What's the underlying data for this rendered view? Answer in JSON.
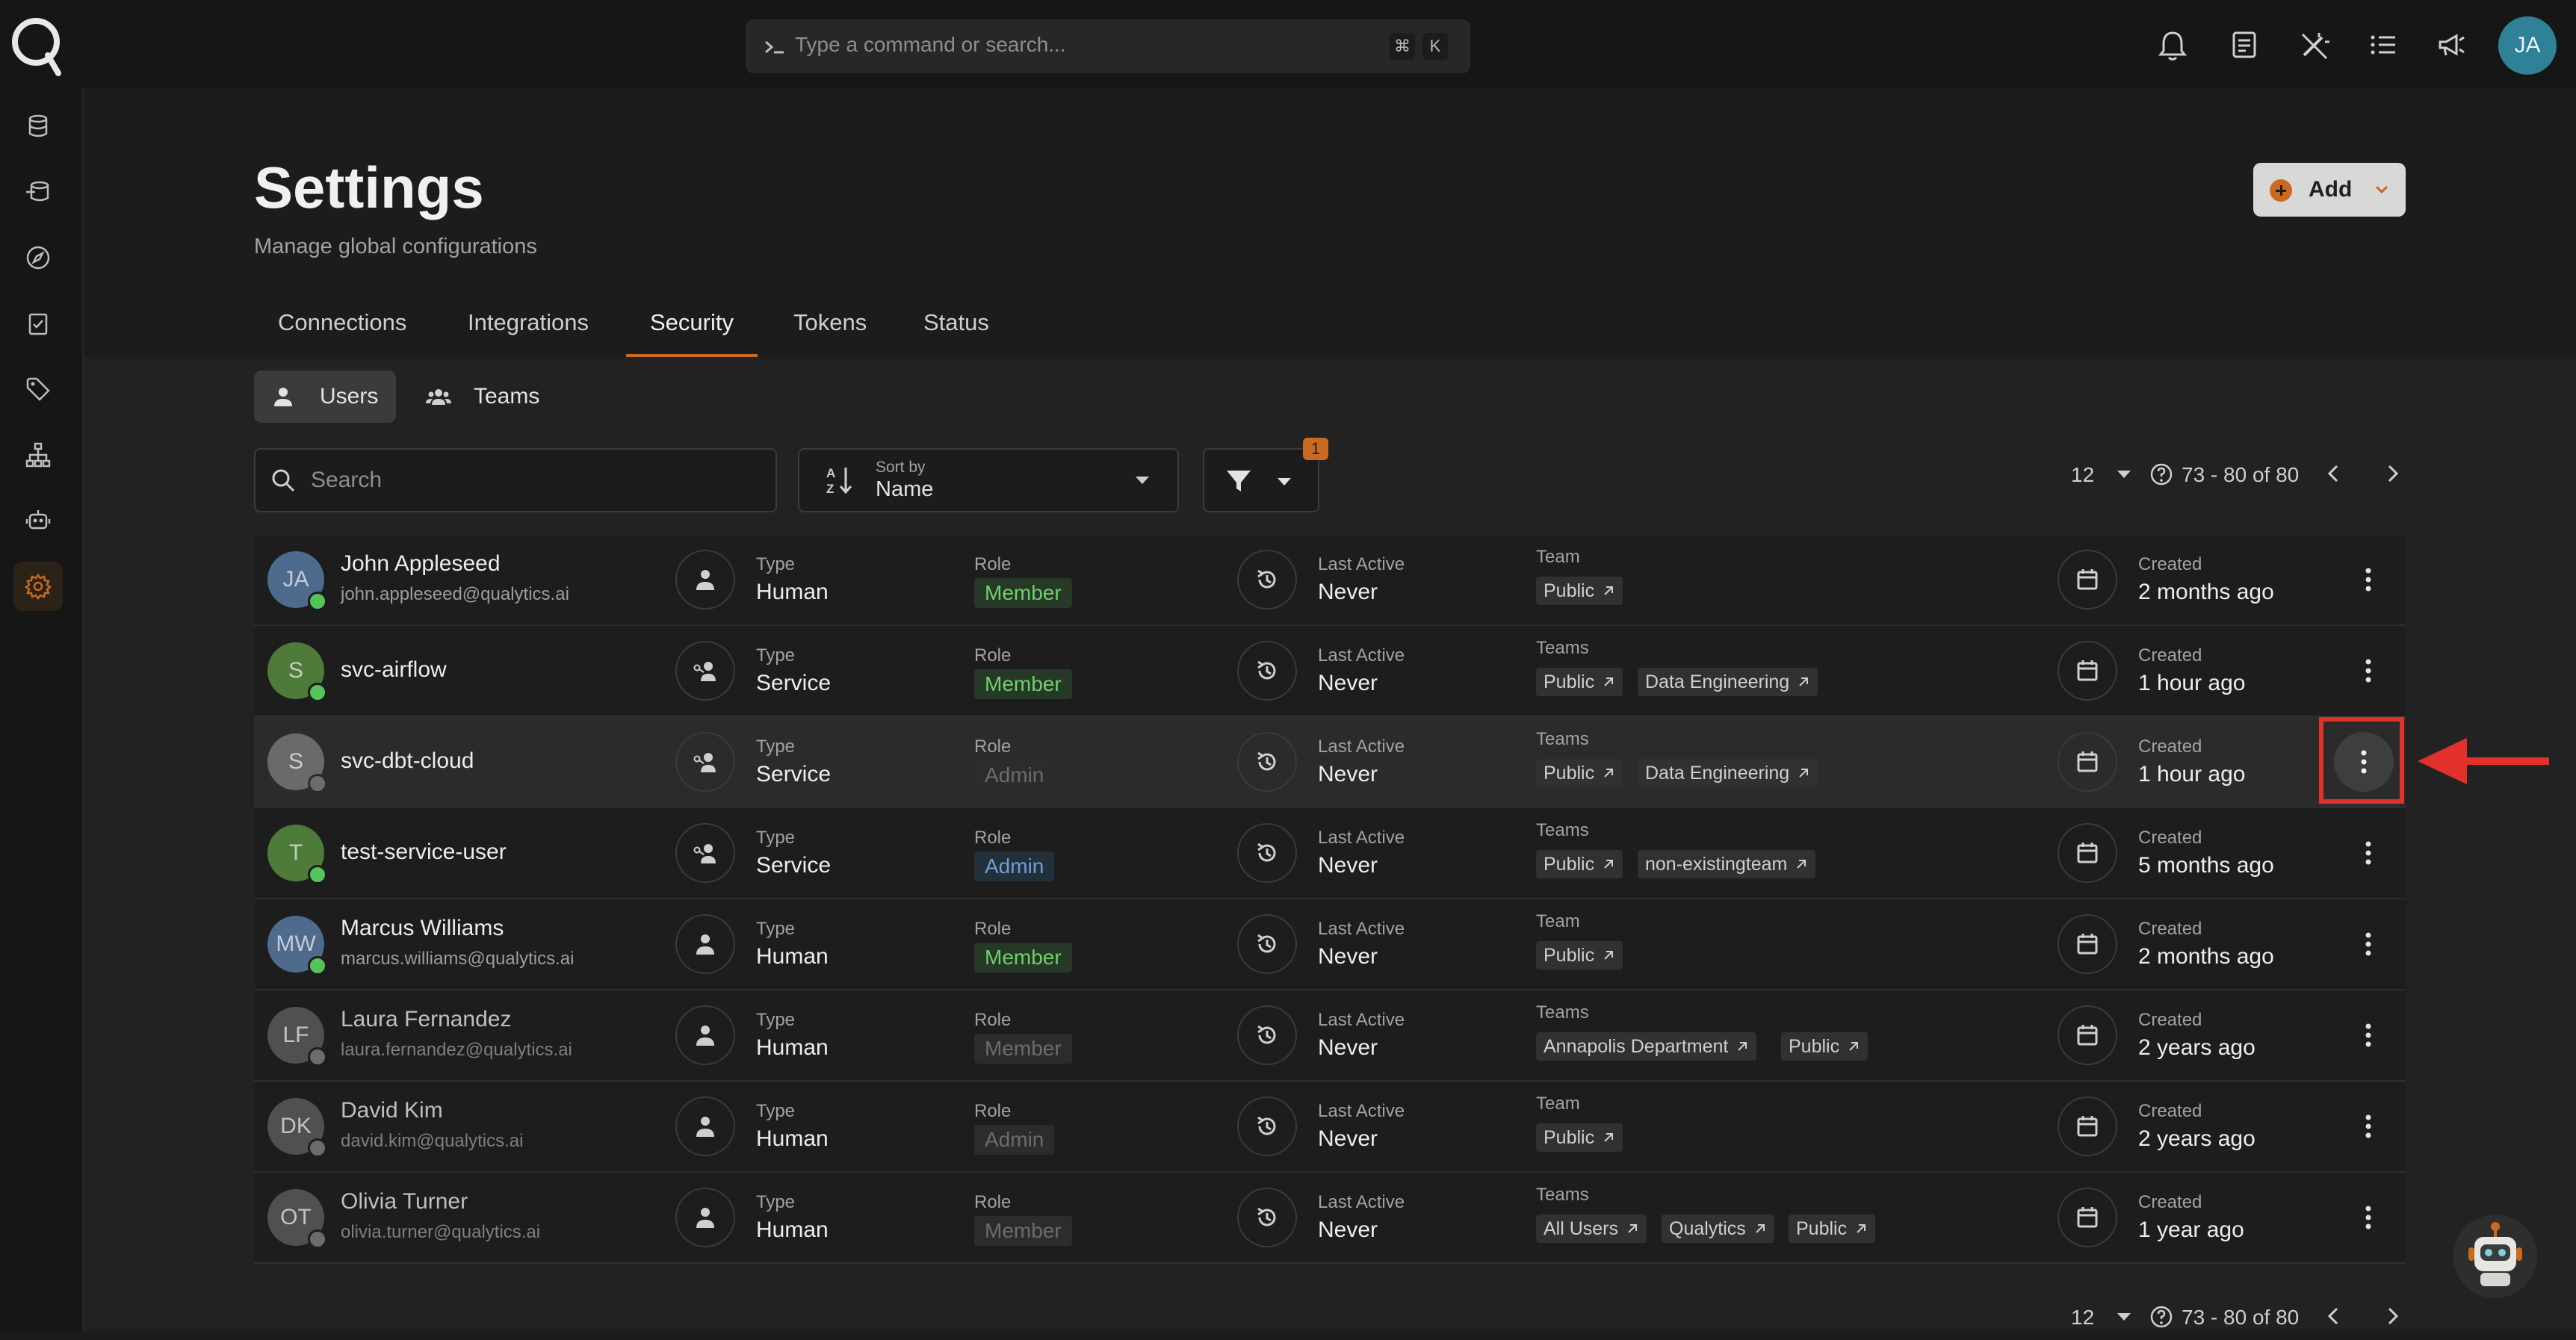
{
  "app": {
    "command_placeholder": "Type a command or search...",
    "shortcut_keys": [
      "⌘",
      "K"
    ],
    "user_initials": "JA",
    "accent_color": "#c96a22",
    "top_icons": [
      "bell-icon",
      "document-icon",
      "magic-wand-icon",
      "list-icon",
      "megaphone-icon"
    ]
  },
  "sidebar": {
    "items": [
      "database-icon",
      "layers-icon",
      "compass-icon",
      "checklist-icon",
      "tag-icon",
      "hierarchy-icon",
      "robot-icon",
      "gear-icon"
    ],
    "active": "gear-icon"
  },
  "page": {
    "title": "Settings",
    "subtitle": "Manage global configurations",
    "add_label": "Add"
  },
  "tabs": [
    "Connections",
    "Integrations",
    "Security",
    "Tokens",
    "Status"
  ],
  "active_tab": "Security",
  "segments": [
    "Users",
    "Teams"
  ],
  "active_segment": "Users",
  "toolbar": {
    "search_placeholder": "Search",
    "sort_label": "Sort by",
    "sort_value": "Name",
    "filter_count": "1"
  },
  "pagination": {
    "page_size": "12",
    "range": "73 - 80 of 80"
  },
  "columns": {
    "type": "Type",
    "role": "Role",
    "last_active": "Last Active",
    "created": "Created"
  },
  "rows": [
    {
      "initials": "JA",
      "name": "John Appleseed",
      "email": "john.appleseed@qualytics.ai",
      "type": "Human",
      "role": "Member",
      "last_active": "Never",
      "team_label": "Team",
      "teams": [
        "Public"
      ],
      "created": "2 months ago"
    },
    {
      "initials": "S",
      "name": "svc-airflow",
      "email": "",
      "type": "Service",
      "role": "Member",
      "last_active": "Never",
      "team_label": "Teams",
      "teams": [
        "Public",
        "Data Engineering"
      ],
      "created": "1 hour ago"
    },
    {
      "initials": "S",
      "name": "svc-dbt-cloud",
      "email": "",
      "type": "Service",
      "role": "Admin",
      "last_active": "Never",
      "team_label": "Teams",
      "teams": [
        "Public",
        "Data Engineering"
      ],
      "created": "1 hour ago"
    },
    {
      "initials": "T",
      "name": "test-service-user",
      "email": "",
      "type": "Service",
      "role": "Admin",
      "last_active": "Never",
      "team_label": "Teams",
      "teams": [
        "Public",
        "non-existingteam"
      ],
      "created": "5 months ago"
    },
    {
      "initials": "MW",
      "name": "Marcus Williams",
      "email": "marcus.williams@qualytics.ai",
      "type": "Human",
      "role": "Member",
      "last_active": "Never",
      "team_label": "Team",
      "teams": [
        "Public"
      ],
      "created": "2 months ago"
    },
    {
      "initials": "LF",
      "name": "Laura Fernandez",
      "email": "laura.fernandez@qualytics.ai",
      "type": "Human",
      "role": "Member",
      "last_active": "Never",
      "team_label": "Teams",
      "teams": [
        "Annapolis Department",
        "Public"
      ],
      "created": "2 years ago"
    },
    {
      "initials": "DK",
      "name": "David Kim",
      "email": "david.kim@qualytics.ai",
      "type": "Human",
      "role": "Admin",
      "last_active": "Never",
      "team_label": "Team",
      "teams": [
        "Public"
      ],
      "created": "2 years ago"
    },
    {
      "initials": "OT",
      "name": "Olivia Turner",
      "email": "olivia.turner@qualytics.ai",
      "type": "Human",
      "role": "Member",
      "last_active": "Never",
      "team_label": "Teams",
      "teams": [
        "All Users",
        "Qualytics",
        "Public"
      ],
      "created": "1 year ago"
    }
  ]
}
